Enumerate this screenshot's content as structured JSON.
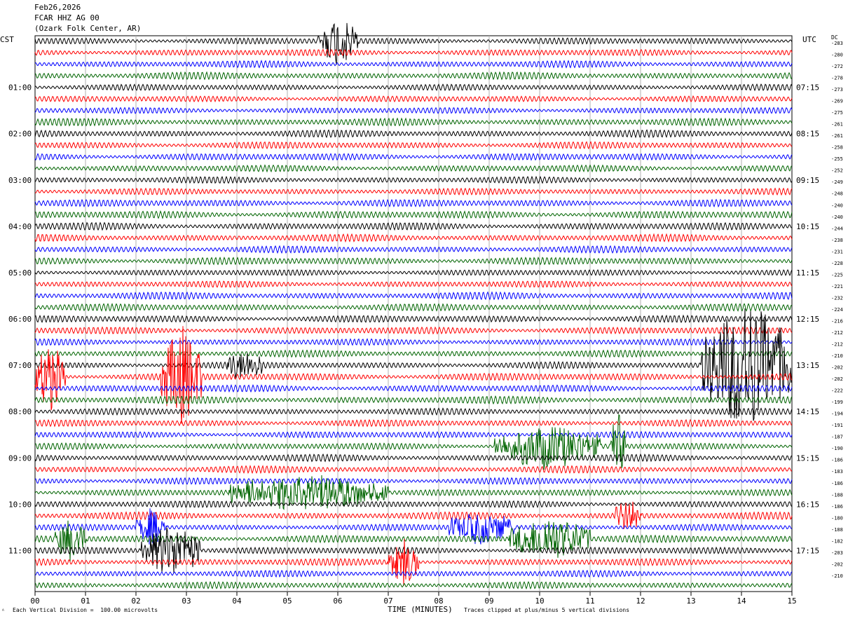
{
  "header": {
    "date": "Feb26,2026",
    "station": "FCAR HHZ AG 00",
    "location": "(Ozark Folk Center, AR)"
  },
  "left_timezone": "CST",
  "right_timezone": "UTC",
  "dc_label": "DC",
  "footer": {
    "scale_note": "Each Vertical Division =  100.00 microvolts",
    "xlabel": "TIME (MINUTES)",
    "clip_note": "Traces clipped at plus/minus 5 vertical divisions",
    "corner_mark": "ᴬ"
  },
  "chart_data": {
    "type": "line",
    "xlabel": "TIME (MINUTES)",
    "xlim": [
      0,
      15
    ],
    "x_ticks": [
      "00",
      "01",
      "02",
      "03",
      "04",
      "05",
      "06",
      "07",
      "08",
      "09",
      "10",
      "11",
      "12",
      "13",
      "14",
      "15"
    ],
    "left_hour_labels": [
      "01:00",
      "02:00",
      "03:00",
      "04:00",
      "05:00",
      "06:00",
      "07:00",
      "08:00",
      "09:00",
      "10:00",
      "11:00"
    ],
    "right_hour_labels": [
      "07:15",
      "08:15",
      "09:15",
      "10:15",
      "11:15",
      "12:15",
      "13:15",
      "14:15",
      "15:15",
      "16:15",
      "17:15"
    ],
    "trace_colors": [
      "#000000",
      "#ff0000",
      "#0000ff",
      "#006400"
    ],
    "dc_offsets": [
      "-283",
      "-280",
      "-272",
      "-278",
      "-273",
      "-269",
      "-275",
      "-261",
      "-261",
      "-258",
      "-255",
      "-252",
      "-249",
      "-248",
      "-240",
      "-240",
      "-244",
      "-238",
      "-231",
      "-228",
      "-225",
      "-221",
      "-232",
      "-224",
      "-216",
      "-212",
      "-212",
      "-210",
      "-202",
      "-202",
      "-222",
      "-199",
      "-194",
      "-191",
      "-187",
      "-190",
      "-186",
      "-183",
      "-186",
      "-188",
      "-186",
      "-180",
      "-188",
      "-182",
      "-203",
      "-202",
      "-210"
    ],
    "traces_count": 48,
    "minutes_per_trace": 15,
    "events": [
      {
        "trace": 0,
        "start_min": 5.6,
        "end_min": 6.4,
        "amp": 2.2
      },
      {
        "trace": 28,
        "start_min": 13.2,
        "end_min": 15.0,
        "amp": 6.0
      },
      {
        "trace": 28,
        "start_min": 3.8,
        "end_min": 4.5,
        "amp": 1.3
      },
      {
        "trace": 29,
        "start_min": 0.0,
        "end_min": 0.6,
        "amp": 3.0
      },
      {
        "trace": 29,
        "start_min": 2.5,
        "end_min": 3.3,
        "amp": 4.5
      },
      {
        "trace": 35,
        "start_min": 9.1,
        "end_min": 11.2,
        "amp": 2.0
      },
      {
        "trace": 35,
        "start_min": 11.4,
        "end_min": 11.7,
        "amp": 3.0
      },
      {
        "trace": 39,
        "start_min": 3.8,
        "end_min": 7.0,
        "amp": 1.6
      },
      {
        "trace": 41,
        "start_min": 11.5,
        "end_min": 12.0,
        "amp": 1.5
      },
      {
        "trace": 42,
        "start_min": 2.0,
        "end_min": 2.6,
        "amp": 1.6
      },
      {
        "trace": 42,
        "start_min": 8.2,
        "end_min": 9.5,
        "amp": 1.5
      },
      {
        "trace": 43,
        "start_min": 0.4,
        "end_min": 1.0,
        "amp": 1.8
      },
      {
        "trace": 43,
        "start_min": 9.4,
        "end_min": 11.0,
        "amp": 2.0
      },
      {
        "trace": 44,
        "start_min": 2.1,
        "end_min": 3.3,
        "amp": 2.4
      },
      {
        "trace": 45,
        "start_min": 7.0,
        "end_min": 7.6,
        "amp": 2.2
      }
    ]
  }
}
